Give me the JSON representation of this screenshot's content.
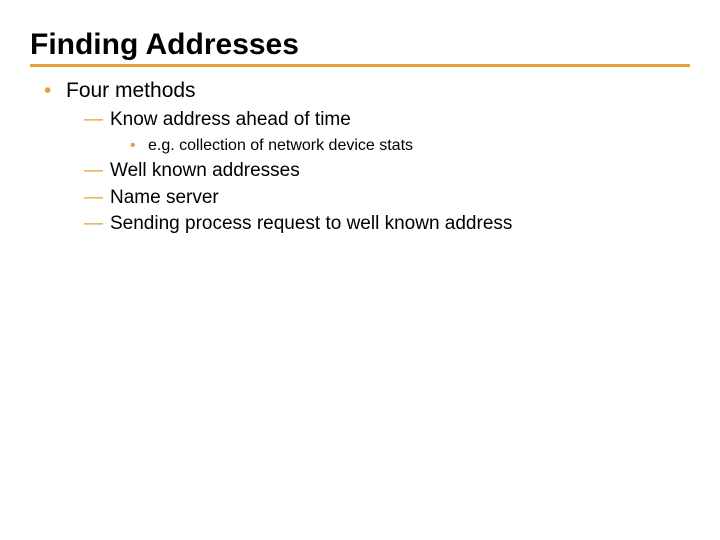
{
  "colors": {
    "accent": "#e6a13a"
  },
  "slide": {
    "title": "Finding Addresses",
    "l0": {
      "0": "Four methods"
    },
    "l1": {
      "0": "Know address ahead of time",
      "1": "Well known addresses",
      "2": "Name server",
      "3": "Sending process request to well known address"
    },
    "l2": {
      "0": "e.g. collection of network device stats"
    }
  }
}
